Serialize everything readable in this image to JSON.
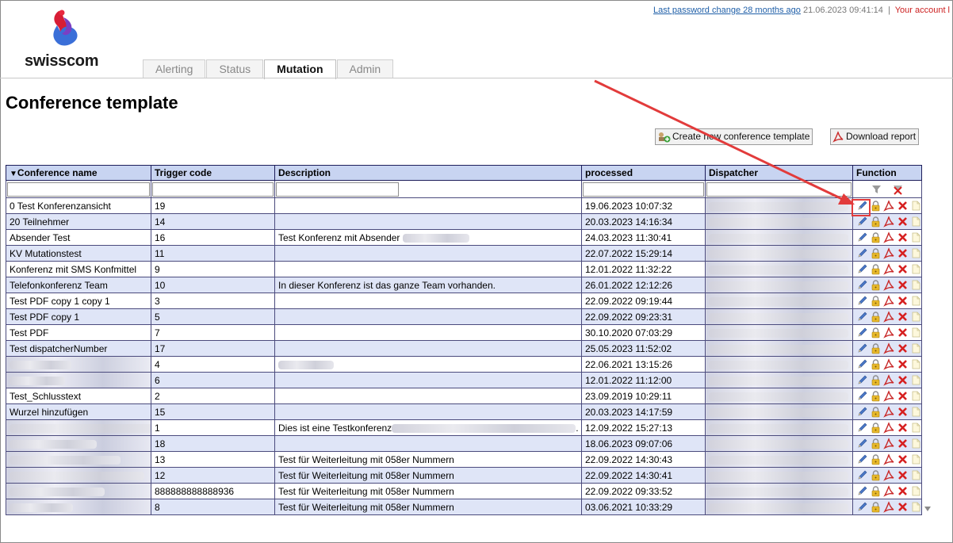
{
  "header": {
    "password_link": "Last password change 28 months ago",
    "datetime": "21.06.2023 09:41:14",
    "separator": "|",
    "account": "Your account l"
  },
  "logo": {
    "word": "swisscom"
  },
  "tabs": [
    {
      "label": "Alerting",
      "active": false
    },
    {
      "label": "Status",
      "active": false
    },
    {
      "label": "Mutation",
      "active": true
    },
    {
      "label": "Admin",
      "active": false
    }
  ],
  "page_title": "Conference template",
  "buttons": {
    "create": "Create new conference template",
    "download": "Download report"
  },
  "columns": [
    "Conference name",
    "Trigger code",
    "Description",
    "processed",
    "Dispatcher",
    "Function"
  ],
  "sort_indicator": "▼",
  "rows": [
    {
      "name": "0 Test Konferenzansicht",
      "code": "19",
      "desc": "",
      "processed": "19.06.2023 10:07:32"
    },
    {
      "name": "20 Teilnehmer",
      "code": "14",
      "desc": "",
      "processed": "20.03.2023 14:16:34"
    },
    {
      "name": "Absender Test",
      "code": "16",
      "desc": "Test Konferenz mit Absender",
      "processed": "24.03.2023 11:30:41"
    },
    {
      "name": "KV Mutationstest",
      "code": "11",
      "desc": "",
      "processed": "22.07.2022 15:29:14"
    },
    {
      "name": "Konferenz mit SMS Konfmittel",
      "code": "9",
      "desc": "",
      "processed": "12.01.2022 11:32:22"
    },
    {
      "name": "Telefonkonferenz Team",
      "code": "10",
      "desc": "In dieser Konferenz ist das ganze Team vorhanden.",
      "processed": "26.01.2022 12:12:26"
    },
    {
      "name": "Test PDF copy 1 copy 1",
      "code": "3",
      "desc": "",
      "processed": "22.09.2022 09:19:44"
    },
    {
      "name": "Test PDF copy 1",
      "code": "5",
      "desc": "",
      "processed": "22.09.2022 09:23:31"
    },
    {
      "name": "Test PDF",
      "code": "7",
      "desc": "",
      "processed": "30.10.2020 07:03:29"
    },
    {
      "name": "Test dispatcherNumber",
      "code": "17",
      "desc": "",
      "processed": "25.05.2023 11:52:02"
    },
    {
      "name": "",
      "code": "4",
      "desc": "",
      "processed": "22.06.2021 13:15:26"
    },
    {
      "name": "",
      "code": "6",
      "desc": "",
      "processed": "12.01.2022 11:12:00"
    },
    {
      "name": "Test_Schlusstext",
      "code": "2",
      "desc": "",
      "processed": "23.09.2019 10:29:11"
    },
    {
      "name": "Wurzel hinzufügen",
      "code": "15",
      "desc": "",
      "processed": "20.03.2023 14:17:59"
    },
    {
      "name": "",
      "code": "1",
      "desc": "Dies ist eine Testkonferenz",
      "processed": "12.09.2022 15:27:13"
    },
    {
      "name": "",
      "code": "18",
      "desc": "",
      "processed": "18.06.2023 09:07:06"
    },
    {
      "name": "",
      "code": "13",
      "desc": "Test für Weiterleitung mit 058er Nummern",
      "processed": "22.09.2022 14:30:43"
    },
    {
      "name": "",
      "code": "12",
      "desc": "Test für Weiterleitung mit 058er Nummern",
      "processed": "22.09.2022 14:30:41"
    },
    {
      "name": "",
      "code": "888888888888936",
      "desc": "Test für Weiterleitung mit 058er Nummern",
      "processed": "22.09.2022 09:33:52"
    },
    {
      "name": "",
      "code": "8",
      "desc": "Test für Weiterleitung mit 058er Nummern",
      "processed": "03.06.2021 10:33:29"
    }
  ],
  "colors": {
    "header_bg": "#c8d4f1",
    "alt_row": "#dfe5f7",
    "annotation": "#e23b3b",
    "link": "#1f5fa8"
  },
  "icons": [
    "edit-icon",
    "lock-icon",
    "pdf-icon",
    "delete-icon",
    "copy-icon",
    "filter-icon",
    "clear-filter-icon"
  ]
}
